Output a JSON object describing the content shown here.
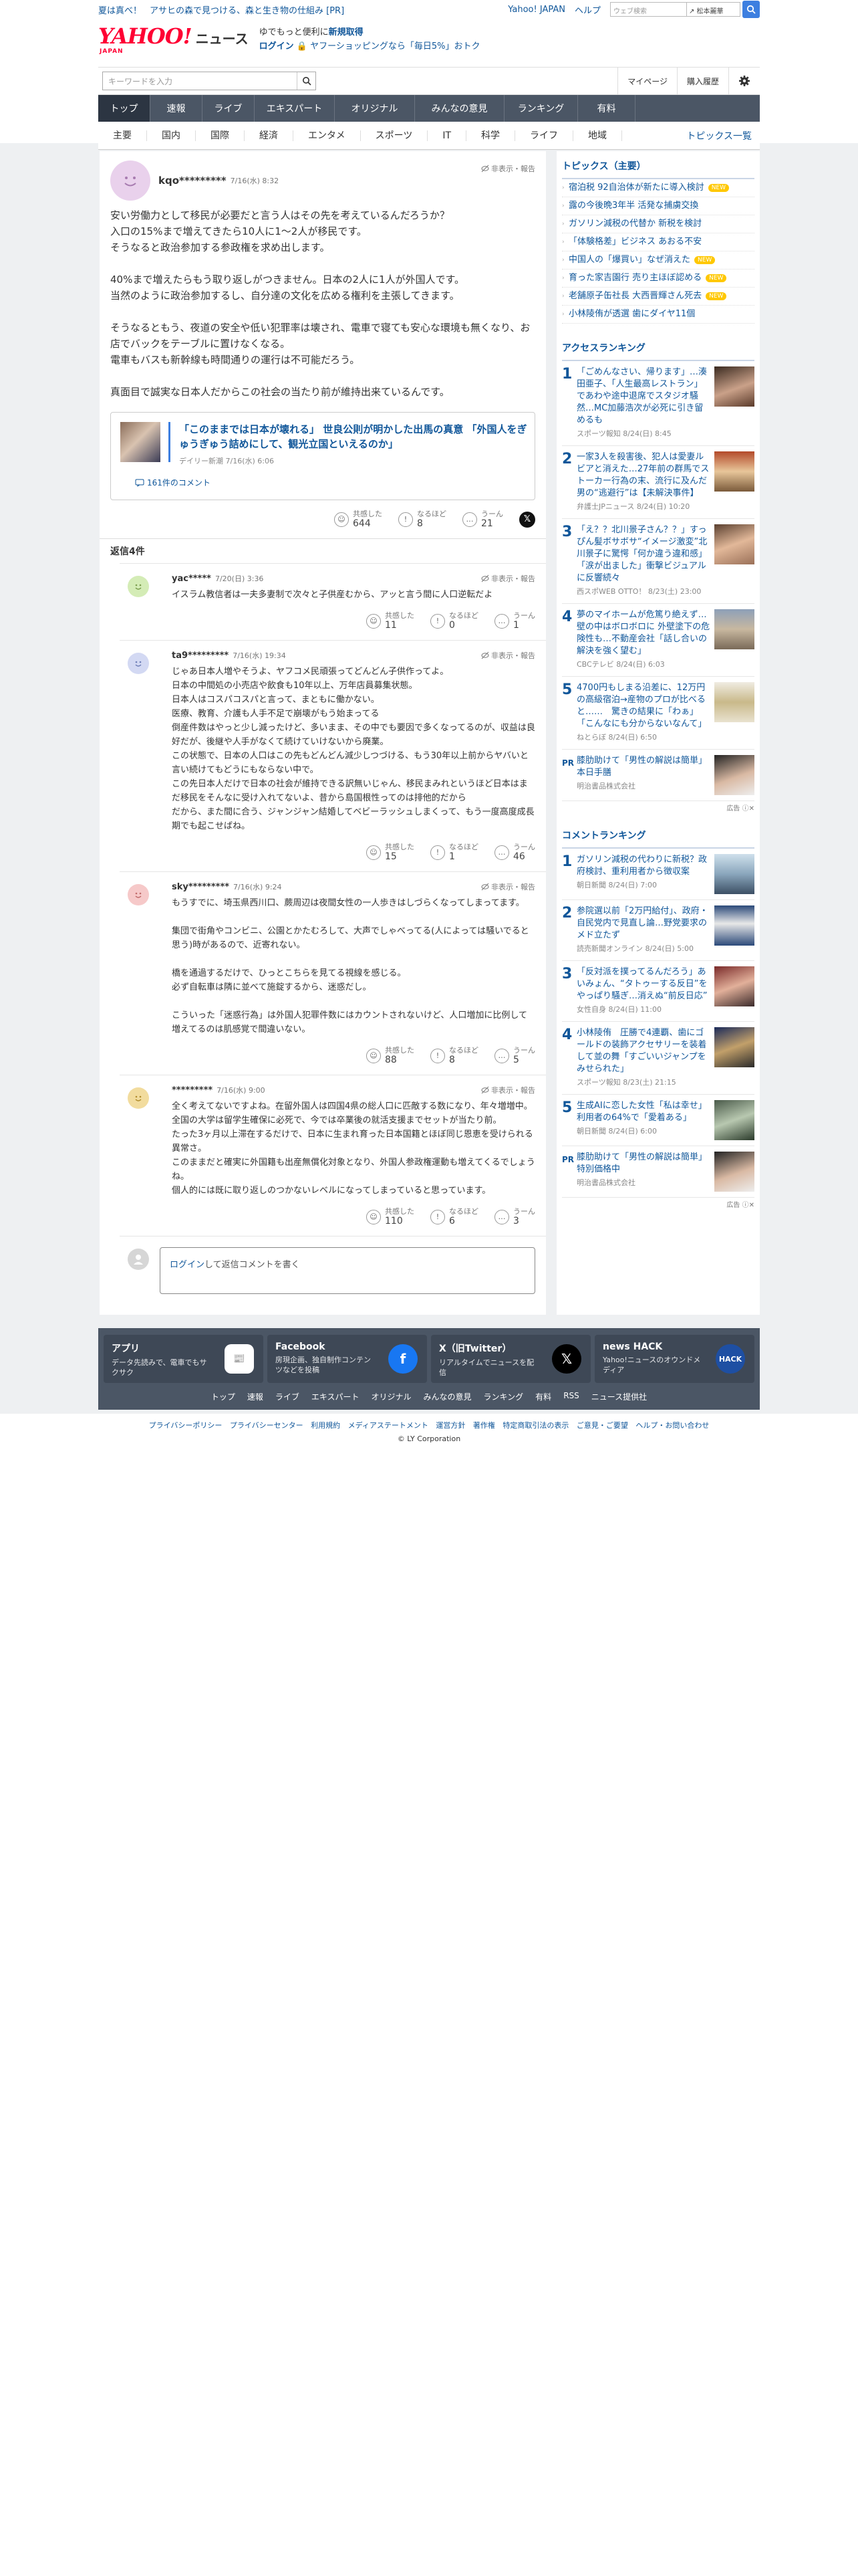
{
  "topbar": {
    "promo1": "夏は真べ！",
    "promo2": "アサヒの森で見つける、森と生き物の仕組み [PR]",
    "yahoo_japan": "Yahoo! JAPAN",
    "help": "ヘルプ",
    "web_search_placeholder": "ウェブ検索",
    "search_mode": "↗ 松本麗華"
  },
  "header": {
    "logo": "YAHOO!",
    "logo_sub": "JAPAN",
    "logo_news": "ニュース",
    "msg_line1_a": "ゆでもっと便利に",
    "msg_line1_b": "新規取得",
    "msg_line2_a": "ログイン",
    "msg_line2_b": "🔒 ヤフーショッピングなら「毎日5%」おトク"
  },
  "search": {
    "placeholder": "キーワードを入力",
    "mypage": "マイページ",
    "history": "購入履歴"
  },
  "nav": {
    "tabs": [
      "トップ",
      "速報",
      "ライブ",
      "エキスパート",
      "オリジナル",
      "みんなの意見",
      "ランキング",
      "有料"
    ]
  },
  "subnav": {
    "items": [
      "主要",
      "国内",
      "国際",
      "経済",
      "エンタメ",
      "スポーツ",
      "IT",
      "科学",
      "ライフ",
      "地域"
    ],
    "topics_list": "トピックス一覧"
  },
  "post": {
    "user": "kqo*********",
    "date": "7/16(水) 8:32",
    "report": "非表示・報告",
    "body": "安い労働力として移民が必要だと言う人はその先を考えているんだろうか？\n入口の15%まで増えてきたら10人に1〜2人が移民です。\nそうなると政治参加する参政権を求め出します。\n\n40%まで増えたらもう取り返しがつきません。日本の2人に1人が外国人です。\n当然のように政治参加するし、自分達の文化を広める権利を主張してきます。\n\nそうなるともう、夜道の安全や低い犯罪率は壊され、電車で寝ても安心な環境も無くなり、お店でバックをテーブルに置けなくなる。\n電車もバスも新幹線も時間通りの運行は不可能だろう。\n\n真面目で誠実な日本人だからこの社会の当たり前が維持出来ているんです。",
    "article_title": "「このままでは日本が壊れる」 世良公則が明かした出馬の真意 「外国人をぎゅうぎゅう詰めにして、観光立国といえるのか」",
    "article_source": "デイリー新潮 7/16(水) 6:06",
    "article_comments": "161件のコメント",
    "react_agree": "共感した",
    "react_agree_n": "644",
    "react_insight": "なるほど",
    "react_insight_n": "8",
    "react_hmm": "うーん",
    "react_hmm_n": "21"
  },
  "replies_title": "返信4件",
  "replies": [
    {
      "user": "yac*****",
      "date": "7/20(日) 3:36",
      "text": "イスラム教信者は一夫多妻制で次々と子供産むから、アッと言う間に人口逆転だよ",
      "agree": "11",
      "insight": "0",
      "hmm": "1"
    },
    {
      "user": "ta9*********",
      "date": "7/16(水) 19:34",
      "text": "じゃあ日本人増やそうよ、ヤフコメ民頑張ってどんどん子供作ってよ。\n日本の中間処の小売店や飲食も10年以上、万年店員募集状態。\n日本人はコスパコスパと言って、まともに働かない。\n医療、教育、介護も人手不足で崩壊がもう始まってる\n倒産件数はやっと少し減ったけど、多いまま、その中でも要因で多くなってるのが、収益は良好だが、後継や人手がなくて続けていけないから廃業。\nこの状態で、日本の人口はこの先もどんどん減少しつづける、もう30年以上前からヤバいと言い続けてもどうにもならない中で。\nこの先日本人だけで日本の社会が維持できる訳無いじゃん、移民まみれというほど日本はまだ移民をそんなに受け入れてないよ、昔から島国根性ってのは排他的だから\nだから、また間に合う、ジャンジャン結婚してベビーラッシュしまくって、もう一度高度成長期でも起こせばね。",
      "agree": "15",
      "insight": "1",
      "hmm": "46"
    },
    {
      "user": "sky*********",
      "date": "7/16(水) 9:24",
      "text": "もうすでに、埼玉県西川口、蕨周辺は夜間女性の一人歩きはしづらくなってしまってます。\n\n集団で街角やコンビニ、公園とかたむろして、大声でしゃべってる(人によっては騒いでると思う)時があるので、近寄れない。\n\n橋を通過するだけで、ひっとこちらを見てる視線を感じる。\n必ず自転車は隣に並べて施錠するから、迷惑だし。\n\nこういった「迷惑行為」は外国人犯罪件数にはカウントされないけど、人口増加に比例して増えてるのは肌感覚で間違いない。",
      "agree": "88",
      "insight": "8",
      "hmm": "5"
    },
    {
      "user": "*********",
      "date": "7/16(水) 9:00",
      "text": "全く考えてないですよね。在留外国人は四国4県の総人口に匹敵する数になり、年々増増中。\n全国の大学は留学生確保に必死で、今では卒業後の就活支援までセットが当たり前。\nたった3ヶ月以上滞在するだけで、日本に生まれ育った日本国籍とほぼ同じ恩恵を受けられる異常さ。\nこのままだと確実に外国籍も出産無償化対象となり、外国人参政権運動も増えてくるでしょうね。\n個人的には既に取り返しのつかないレベルになってしまっていると思っています。",
      "agree": "110",
      "insight": "6",
      "hmm": "3"
    }
  ],
  "reply_box": {
    "login": "ログイン",
    "prompt": "して返信コメントを書く"
  },
  "sidebar": {
    "topics_title": "トピックス（主要）",
    "topics": [
      {
        "text": "宿泊税 92自治体が新たに導入検討",
        "new": "NEW"
      },
      {
        "text": "露の今後晩3年半 活発な捕虜交換",
        "new": ""
      },
      {
        "text": "ガソリン減税の代替か 新税を検討",
        "new": ""
      },
      {
        "text": "「体験格差」ビジネス あおる不安",
        "new": ""
      },
      {
        "text": "中国人の「爆買い」なぜ消えた",
        "new": "NEW"
      },
      {
        "text": "育った家吉園行 売り主ほぼ認める",
        "new": "NEW"
      },
      {
        "text": "老舗原子缶社長 大西晋輝さん死去",
        "new": "NEW"
      },
      {
        "text": "小林陵侑が透選 歯にダイヤ11個",
        "new": ""
      }
    ],
    "access_title": "アクセスランキング",
    "access": [
      {
        "n": "1",
        "text": "「ごめんなさい、帰ります」…湊田亜子、「人生最高レストラン」であわや途中退席でスタジオ騒然…MC加藤浩次が必死に引き留めるも",
        "src": "スポーツ報知 8/24(日) 8:45"
      },
      {
        "n": "2",
        "text": "一家3人を殺害後、犯人は愛妻ルビアと消えた…27年前の群馬でストーカー行為の末、流行に及んだ男の“逃避行”は【未解決事件】",
        "src": "弁護士JPニュース 8/24(日) 10:20"
      },
      {
        "n": "3",
        "text": "「え？？北川景子さん？？」すっぴん髪ボサボサ“イメージ激変”北川景子に驚愕「何か違う違和感」「涙が出ました」衝撃ビジュアルに反響続々",
        "src": "西スポWEB OTTO！ 8/23(土) 23:00"
      },
      {
        "n": "4",
        "text": "夢のマイホームが危篤り絶えず…壁の中はボロボロに 外壁塗下の危険性も…不動産会社「話し合いの解決を強く望む」",
        "src": "CBCテレビ 8/24(日) 6:03"
      },
      {
        "n": "5",
        "text": "4700円もしまる沿差に、12万円の高級宿泊→産物のプロが比べると……　驚きの結果に「わぁ」「こんなにも分からないなんて」",
        "src": "ねとらぼ 8/24(日) 6:50"
      }
    ],
    "pr1_title": "膝肋助けて「男性の解説は簡単」本日手膳",
    "pr1_src": "明治書品株式会社",
    "pr_label": "PR",
    "ad_label": "広告",
    "comment_title": "コメントランキング",
    "comments": [
      {
        "n": "1",
        "text": "ガソリン減税の代わりに新税？政府検討、重利用者から徴収案",
        "src": "朝日新聞 8/24(日) 7:00"
      },
      {
        "n": "2",
        "text": "参院選以前「2万円給付」、政府・自民党内で見直し論…野党要求のメド立たず",
        "src": "読売新聞オンライン 8/24(日) 5:00"
      },
      {
        "n": "3",
        "text": "「反対派を撲ってるんだろう」あいみょん、“タトゥーする反日”をやっぱり騒ぎ…消えぬ“前反日応”",
        "src": "女性自身 8/24(日) 11:00"
      },
      {
        "n": "4",
        "text": "小林陵侑　圧勝で4連覇、歯にゴールドの装飾アクセサリーを装着して並の舞「すごいいジャンプをみせられた」",
        "src": "スポーツ報知 8/23(土) 21:15"
      },
      {
        "n": "5",
        "text": "生成AIに恋した女性「私は幸せ」利用者の64%で「愛着ある」",
        "src": "朝日新聞 8/24(日) 6:00"
      }
    ],
    "pr2_title": "膝肋助けて「男性の解説は簡単」特別価格中",
    "pr2_src": "明治書品株式会社"
  },
  "footer": {
    "apps": [
      {
        "title": "アプリ",
        "desc": "データ先読みで、電車でもサクサク"
      },
      {
        "title": "Facebook",
        "desc": "房現企画、独自制作コンテンツなどを投稿"
      },
      {
        "title": "X（旧Twitter）",
        "desc": "リアルタイムでニュースを配信"
      },
      {
        "title": "news HACK",
        "desc": "Yahoo!ニュースのオウンドメディア"
      }
    ],
    "links": [
      "トップ",
      "速報",
      "ライブ",
      "エキスパート",
      "オリジナル",
      "みんなの意見",
      "ランキング",
      "有料",
      "RSS",
      "ニュース提供社"
    ],
    "legal_links": [
      "プライバシーポリシー",
      "プライバシーセンター",
      "利用規約",
      "メディアステートメント",
      "運営方針",
      "著作権",
      "特定商取引法の表示",
      "ご意見・ご要望",
      "ヘルプ・お問い合わせ"
    ],
    "copyright": "© LY Corporation"
  },
  "colors": {
    "accent": "#11579a",
    "nav": "#4b5665",
    "brand_red": "#ff0033"
  }
}
